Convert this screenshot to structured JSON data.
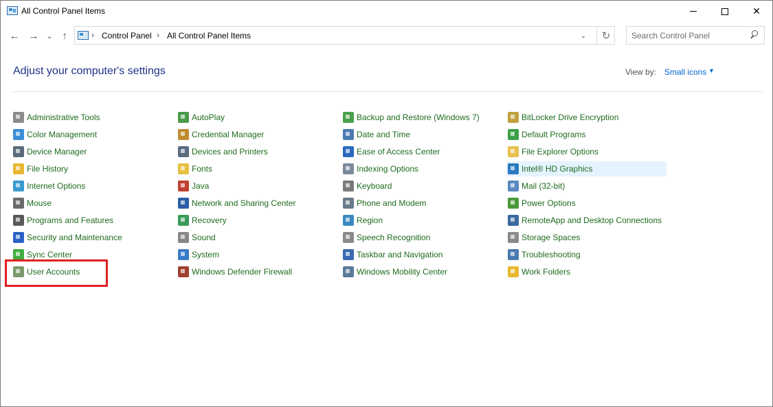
{
  "window": {
    "title": "All Control Panel Items",
    "close_glyph": "✕"
  },
  "nav": {
    "back_glyph": "←",
    "forward_glyph": "→",
    "recent_glyph": "⌄",
    "up_glyph": "↑",
    "breadcrumb": [
      "Control Panel",
      "All Control Panel Items"
    ],
    "sep_glyph": "›",
    "dropdown_glyph": "⌄",
    "refresh_glyph": "↻"
  },
  "search": {
    "placeholder": "Search Control Panel"
  },
  "header": {
    "title": "Adjust your computer's settings",
    "view_by_label": "View by:",
    "view_by_value": "Small icons",
    "caret": "▼"
  },
  "columns": [
    {
      "items": [
        {
          "label": "Administrative Tools",
          "icon": "admin-tools-icon",
          "color": "#8a8a8a"
        },
        {
          "label": "Color Management",
          "icon": "color-management-icon",
          "color": "#3a8fd6"
        },
        {
          "label": "Device Manager",
          "icon": "device-manager-icon",
          "color": "#5a6a7a"
        },
        {
          "label": "File History",
          "icon": "file-history-icon",
          "color": "#e8b830"
        },
        {
          "label": "Internet Options",
          "icon": "internet-options-icon",
          "color": "#3a9bd0"
        },
        {
          "label": "Mouse",
          "icon": "mouse-icon",
          "color": "#6b6b6b"
        },
        {
          "label": "Programs and Features",
          "icon": "programs-features-icon",
          "color": "#5a5a5a"
        },
        {
          "label": "Security and Maintenance",
          "icon": "security-flag-icon",
          "color": "#2a62c4"
        },
        {
          "label": "Sync Center",
          "icon": "sync-center-icon",
          "color": "#3fae3f"
        },
        {
          "label": "User Accounts",
          "icon": "user-accounts-icon",
          "color": "#7a9a6a"
        }
      ]
    },
    {
      "items": [
        {
          "label": "AutoPlay",
          "icon": "autoplay-icon",
          "color": "#4a9a4a"
        },
        {
          "label": "Credential Manager",
          "icon": "credential-manager-icon",
          "color": "#c08a30"
        },
        {
          "label": "Devices and Printers",
          "icon": "devices-printers-icon",
          "color": "#5a6e80"
        },
        {
          "label": "Fonts",
          "icon": "fonts-icon",
          "color": "#e8c040"
        },
        {
          "label": "Java",
          "icon": "java-icon",
          "color": "#c04030"
        },
        {
          "label": "Network and Sharing Center",
          "icon": "network-sharing-icon",
          "color": "#2a5ea8"
        },
        {
          "label": "Recovery",
          "icon": "recovery-icon",
          "color": "#3a9a5a"
        },
        {
          "label": "Sound",
          "icon": "sound-icon",
          "color": "#888888"
        },
        {
          "label": "System",
          "icon": "system-icon",
          "color": "#3a7cc8"
        },
        {
          "label": "Windows Defender Firewall",
          "icon": "firewall-icon",
          "color": "#a04030"
        }
      ]
    },
    {
      "items": [
        {
          "label": "Backup and Restore (Windows 7)",
          "icon": "backup-restore-icon",
          "color": "#4aa04a"
        },
        {
          "label": "Date and Time",
          "icon": "date-time-icon",
          "color": "#4a7ab0"
        },
        {
          "label": "Ease of Access Center",
          "icon": "ease-of-access-icon",
          "color": "#2a6ac0"
        },
        {
          "label": "Indexing Options",
          "icon": "indexing-options-icon",
          "color": "#7a8a9a"
        },
        {
          "label": "Keyboard",
          "icon": "keyboard-icon",
          "color": "#7a7a7a"
        },
        {
          "label": "Phone and Modem",
          "icon": "phone-modem-icon",
          "color": "#6a7a8a"
        },
        {
          "label": "Region",
          "icon": "region-globe-icon",
          "color": "#3a8ac0"
        },
        {
          "label": "Speech Recognition",
          "icon": "microphone-icon",
          "color": "#8a8a8a"
        },
        {
          "label": "Taskbar and Navigation",
          "icon": "taskbar-icon",
          "color": "#3a6ab0"
        },
        {
          "label": "Windows Mobility Center",
          "icon": "mobility-center-icon",
          "color": "#5a7a9a"
        }
      ]
    },
    {
      "items": [
        {
          "label": "BitLocker Drive Encryption",
          "icon": "bitlocker-icon",
          "color": "#c0a040"
        },
        {
          "label": "Default Programs",
          "icon": "default-programs-icon",
          "color": "#3aa04a"
        },
        {
          "label": "File Explorer Options",
          "icon": "file-explorer-options-icon",
          "color": "#e8c050"
        },
        {
          "label": "Intel® HD Graphics",
          "icon": "intel-graphics-icon",
          "color": "#2a7ac0"
        },
        {
          "label": "Mail (32-bit)",
          "icon": "mail-icon",
          "color": "#5a8ac0"
        },
        {
          "label": "Power Options",
          "icon": "power-options-icon",
          "color": "#4a9a3a"
        },
        {
          "label": "RemoteApp and Desktop Connections",
          "icon": "remoteapp-icon",
          "color": "#3a6aa0"
        },
        {
          "label": "Storage Spaces",
          "icon": "storage-spaces-icon",
          "color": "#8a8a8a"
        },
        {
          "label": "Troubleshooting",
          "icon": "troubleshooting-icon",
          "color": "#4a7ab0"
        },
        {
          "label": "Work Folders",
          "icon": "work-folders-icon",
          "color": "#e8b830"
        }
      ]
    }
  ],
  "highlighted_item": "Intel® HD Graphics",
  "annotation": {
    "target": "User Accounts",
    "color": "#e02020"
  }
}
